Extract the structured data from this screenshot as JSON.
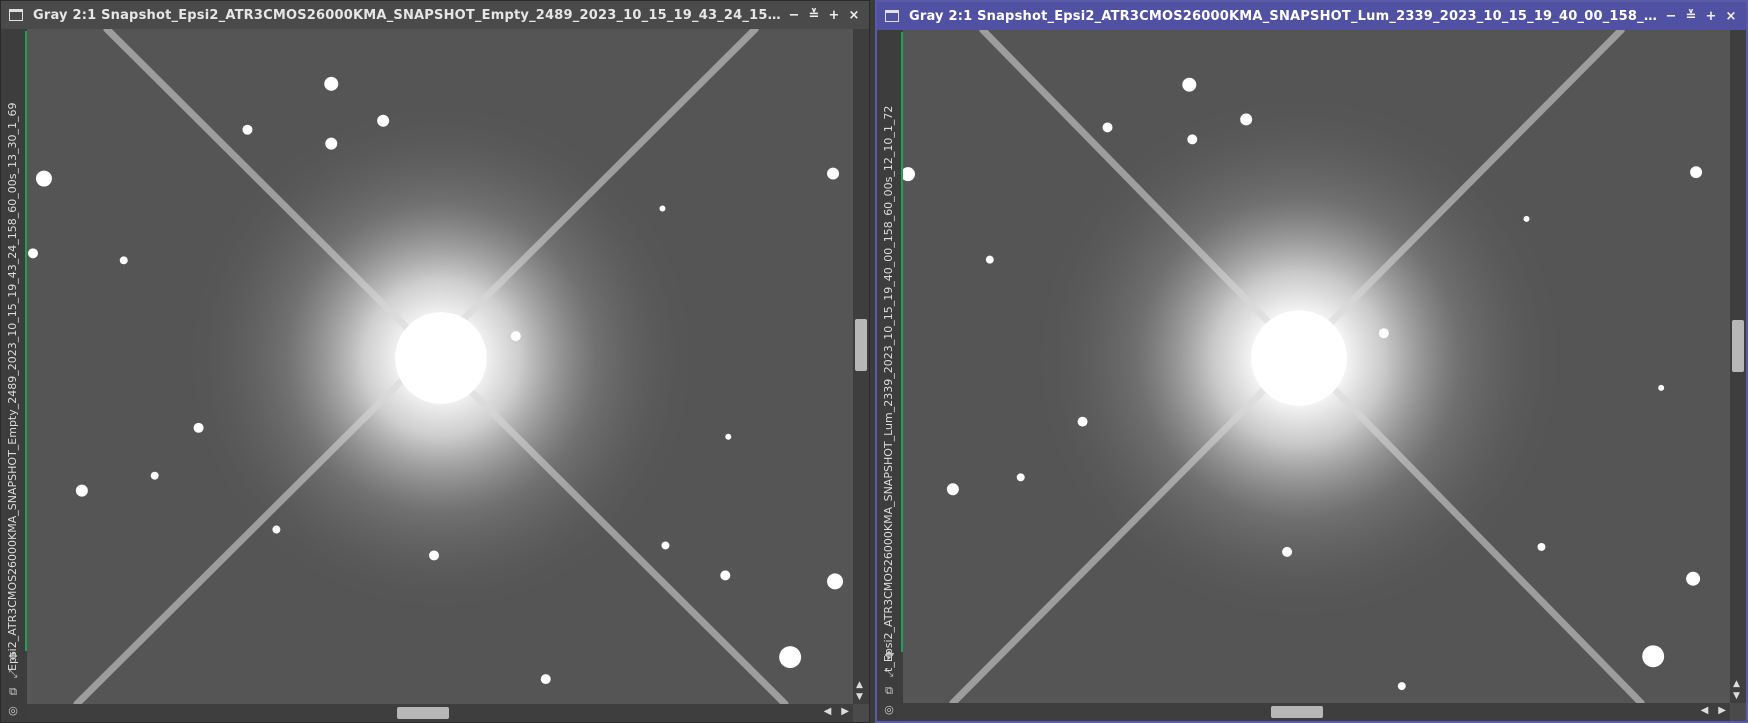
{
  "windows": [
    {
      "title": "Gray 2:1 Snapshot_Epsi2_ATR3CMOS26000KMA_SNAPSHOT_Empty_2489_2023_10_15_19_43_24_158...",
      "side_label": "Epsi2_ATR3CMOS26000KMA_SNAPSHOT_Empty_2489_2023_10_15_19_43_24_158_60_00s_13_30_1_69",
      "controls": {
        "minimize": "−",
        "shade": "≚",
        "maximize": "+",
        "close": "×"
      },
      "active": false
    },
    {
      "title": "Gray 2:1 Snapshot_Epsi2_ATR3CMOS26000KMA_SNAPSHOT_Lum_2339_2023_10_15_19_40_00_158_6...",
      "side_label": "t_Epsi2_ATR3CMOS26000KMA_SNAPSHOT_Lum_2339_2023_10_15_19_40_00_158_60_00s_12_10_1_72",
      "controls": {
        "minimize": "−",
        "shade": "≚",
        "maximize": "+",
        "close": "×"
      },
      "active": true
    }
  ],
  "icons": {
    "window_icon": "window-icon",
    "tools": [
      "pan-icon",
      "zoom-fit-icon",
      "clone-icon",
      "target-icon"
    ],
    "scroll": {
      "up": "▲",
      "down": "▼",
      "left": "◀",
      "right": "▶"
    }
  },
  "colors": {
    "active_title": "#5151a3",
    "inactive_title": "#4a4a4a",
    "side_marker": "#1fa05a"
  }
}
